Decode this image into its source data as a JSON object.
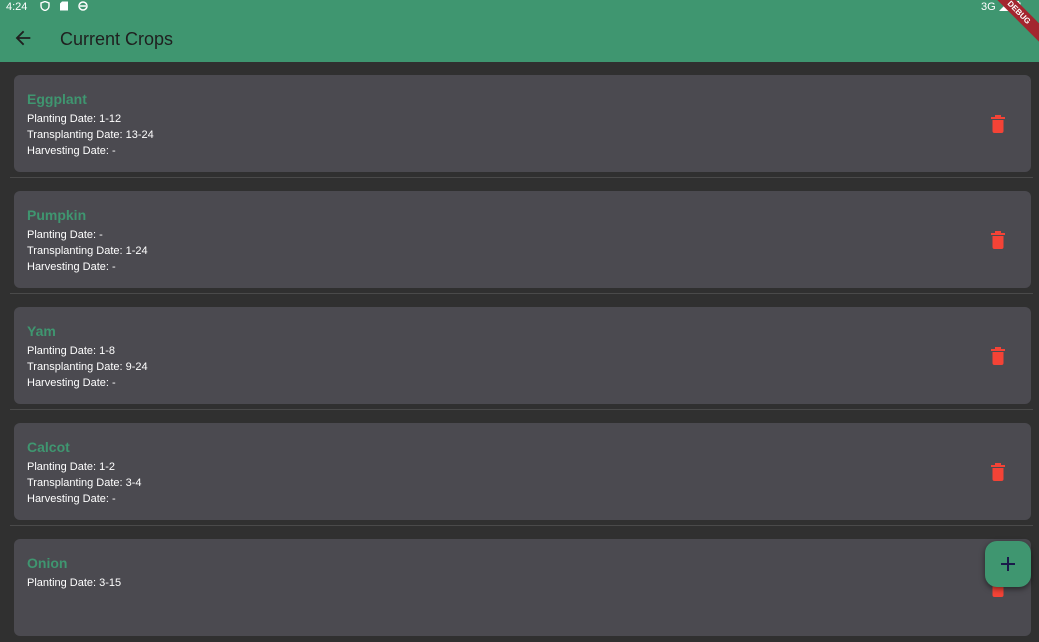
{
  "status_bar": {
    "time": "4:24",
    "network": "3G"
  },
  "app_bar": {
    "title": "Current Crops"
  },
  "debug_banner": "DEBUG",
  "labels": {
    "planting": "Planting Date: ",
    "transplanting": "Transplanting Date: ",
    "harvesting": "Harvesting Date: "
  },
  "crops": [
    {
      "name": "Eggplant",
      "planting": "1-12",
      "transplanting": "13-24",
      "harvesting": "-"
    },
    {
      "name": "Pumpkin",
      "planting": "-",
      "transplanting": "1-24",
      "harvesting": "-"
    },
    {
      "name": "Yam",
      "planting": "1-8",
      "transplanting": "9-24",
      "harvesting": "-"
    },
    {
      "name": "Calcot",
      "planting": "1-2",
      "transplanting": "3-4",
      "harvesting": "-"
    },
    {
      "name": "Onion",
      "planting": "3-15"
    }
  ],
  "colors": {
    "primary": "#3f9670",
    "background": "#303030",
    "card": "#4b4a50",
    "delete": "#f44336"
  },
  "icons": {
    "back": "arrow-left",
    "delete": "trash",
    "fab": "plus"
  }
}
